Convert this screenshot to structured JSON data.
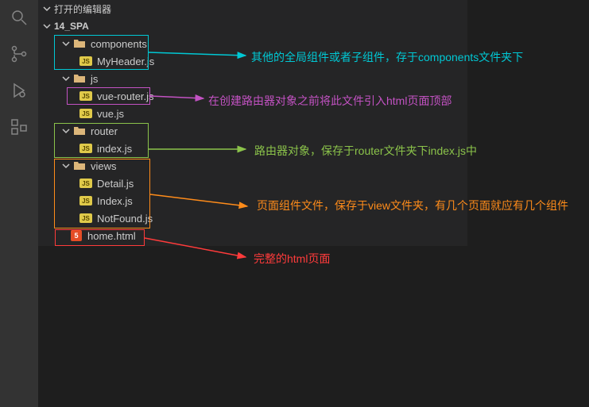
{
  "sections": {
    "open_editors": "打开的编辑器",
    "project": "14_SPA"
  },
  "tree": {
    "components": {
      "label": "components",
      "file1": "MyHeader.js"
    },
    "js": {
      "label": "js",
      "file1": "vue-router.js",
      "file2": "vue.js"
    },
    "router": {
      "label": "router",
      "file1": "index.js"
    },
    "views": {
      "label": "views",
      "file1": "Detail.js",
      "file2": "Index.js",
      "file3": "NotFound.js"
    },
    "home": "home.html"
  },
  "icons": {
    "js": "JS",
    "html": "5"
  },
  "annotations": {
    "a1": "其他的全局组件或者子组件，存于components文件夹下",
    "a2": "在创建路由器对象之前将此文件引入html页面顶部",
    "a3": "路由器对象，保存于router文件夹下index.js中",
    "a4": "页面组件文件，保存于view文件夹，有几个页面就应有几个组件",
    "a5": "完整的html页面"
  },
  "colors": {
    "c1": "#00c8d4",
    "c2": "#c352c3",
    "c3": "#8bc34a",
    "c4": "#ff8c1a",
    "c5": "#ff3b3b"
  }
}
